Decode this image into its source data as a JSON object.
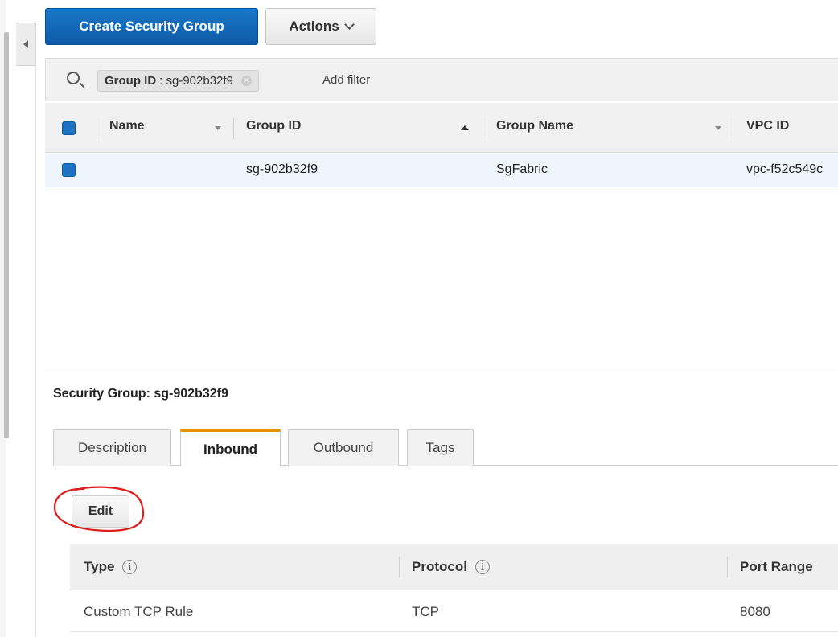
{
  "toolbar": {
    "create_label": "Create Security Group",
    "actions_label": "Actions"
  },
  "filter": {
    "token_key": "Group ID",
    "token_value": ": sg-902b32f9",
    "add_filter": "Add filter"
  },
  "grid": {
    "columns": [
      "Name",
      "Group ID",
      "Group Name",
      "VPC ID"
    ],
    "rows": [
      {
        "name": "",
        "group_id": "sg-902b32f9",
        "group_name": "SgFabric",
        "vpc_id": "vpc-f52c549c"
      }
    ]
  },
  "details": {
    "title": "Security Group: sg-902b32f9",
    "tabs": [
      "Description",
      "Inbound",
      "Outbound",
      "Tags"
    ],
    "active_tab": "Inbound",
    "edit_label": "Edit"
  },
  "rules": {
    "columns": [
      "Type",
      "Protocol",
      "Port Range"
    ],
    "info_glyph": "i",
    "rows": [
      {
        "type": "Custom TCP Rule",
        "protocol": "TCP",
        "port_range": "8080"
      }
    ]
  },
  "colors": {
    "primary": "#1a78c8",
    "selected_row": "#eef5fd",
    "active_tab_accent": "#e59400",
    "annotation": "#e01b1b"
  },
  "icons": [
    "collapse-left-icon",
    "chevron-down-icon",
    "search-icon",
    "remove-token-icon",
    "sort-down-icon",
    "sort-up-icon",
    "info-icon"
  ]
}
